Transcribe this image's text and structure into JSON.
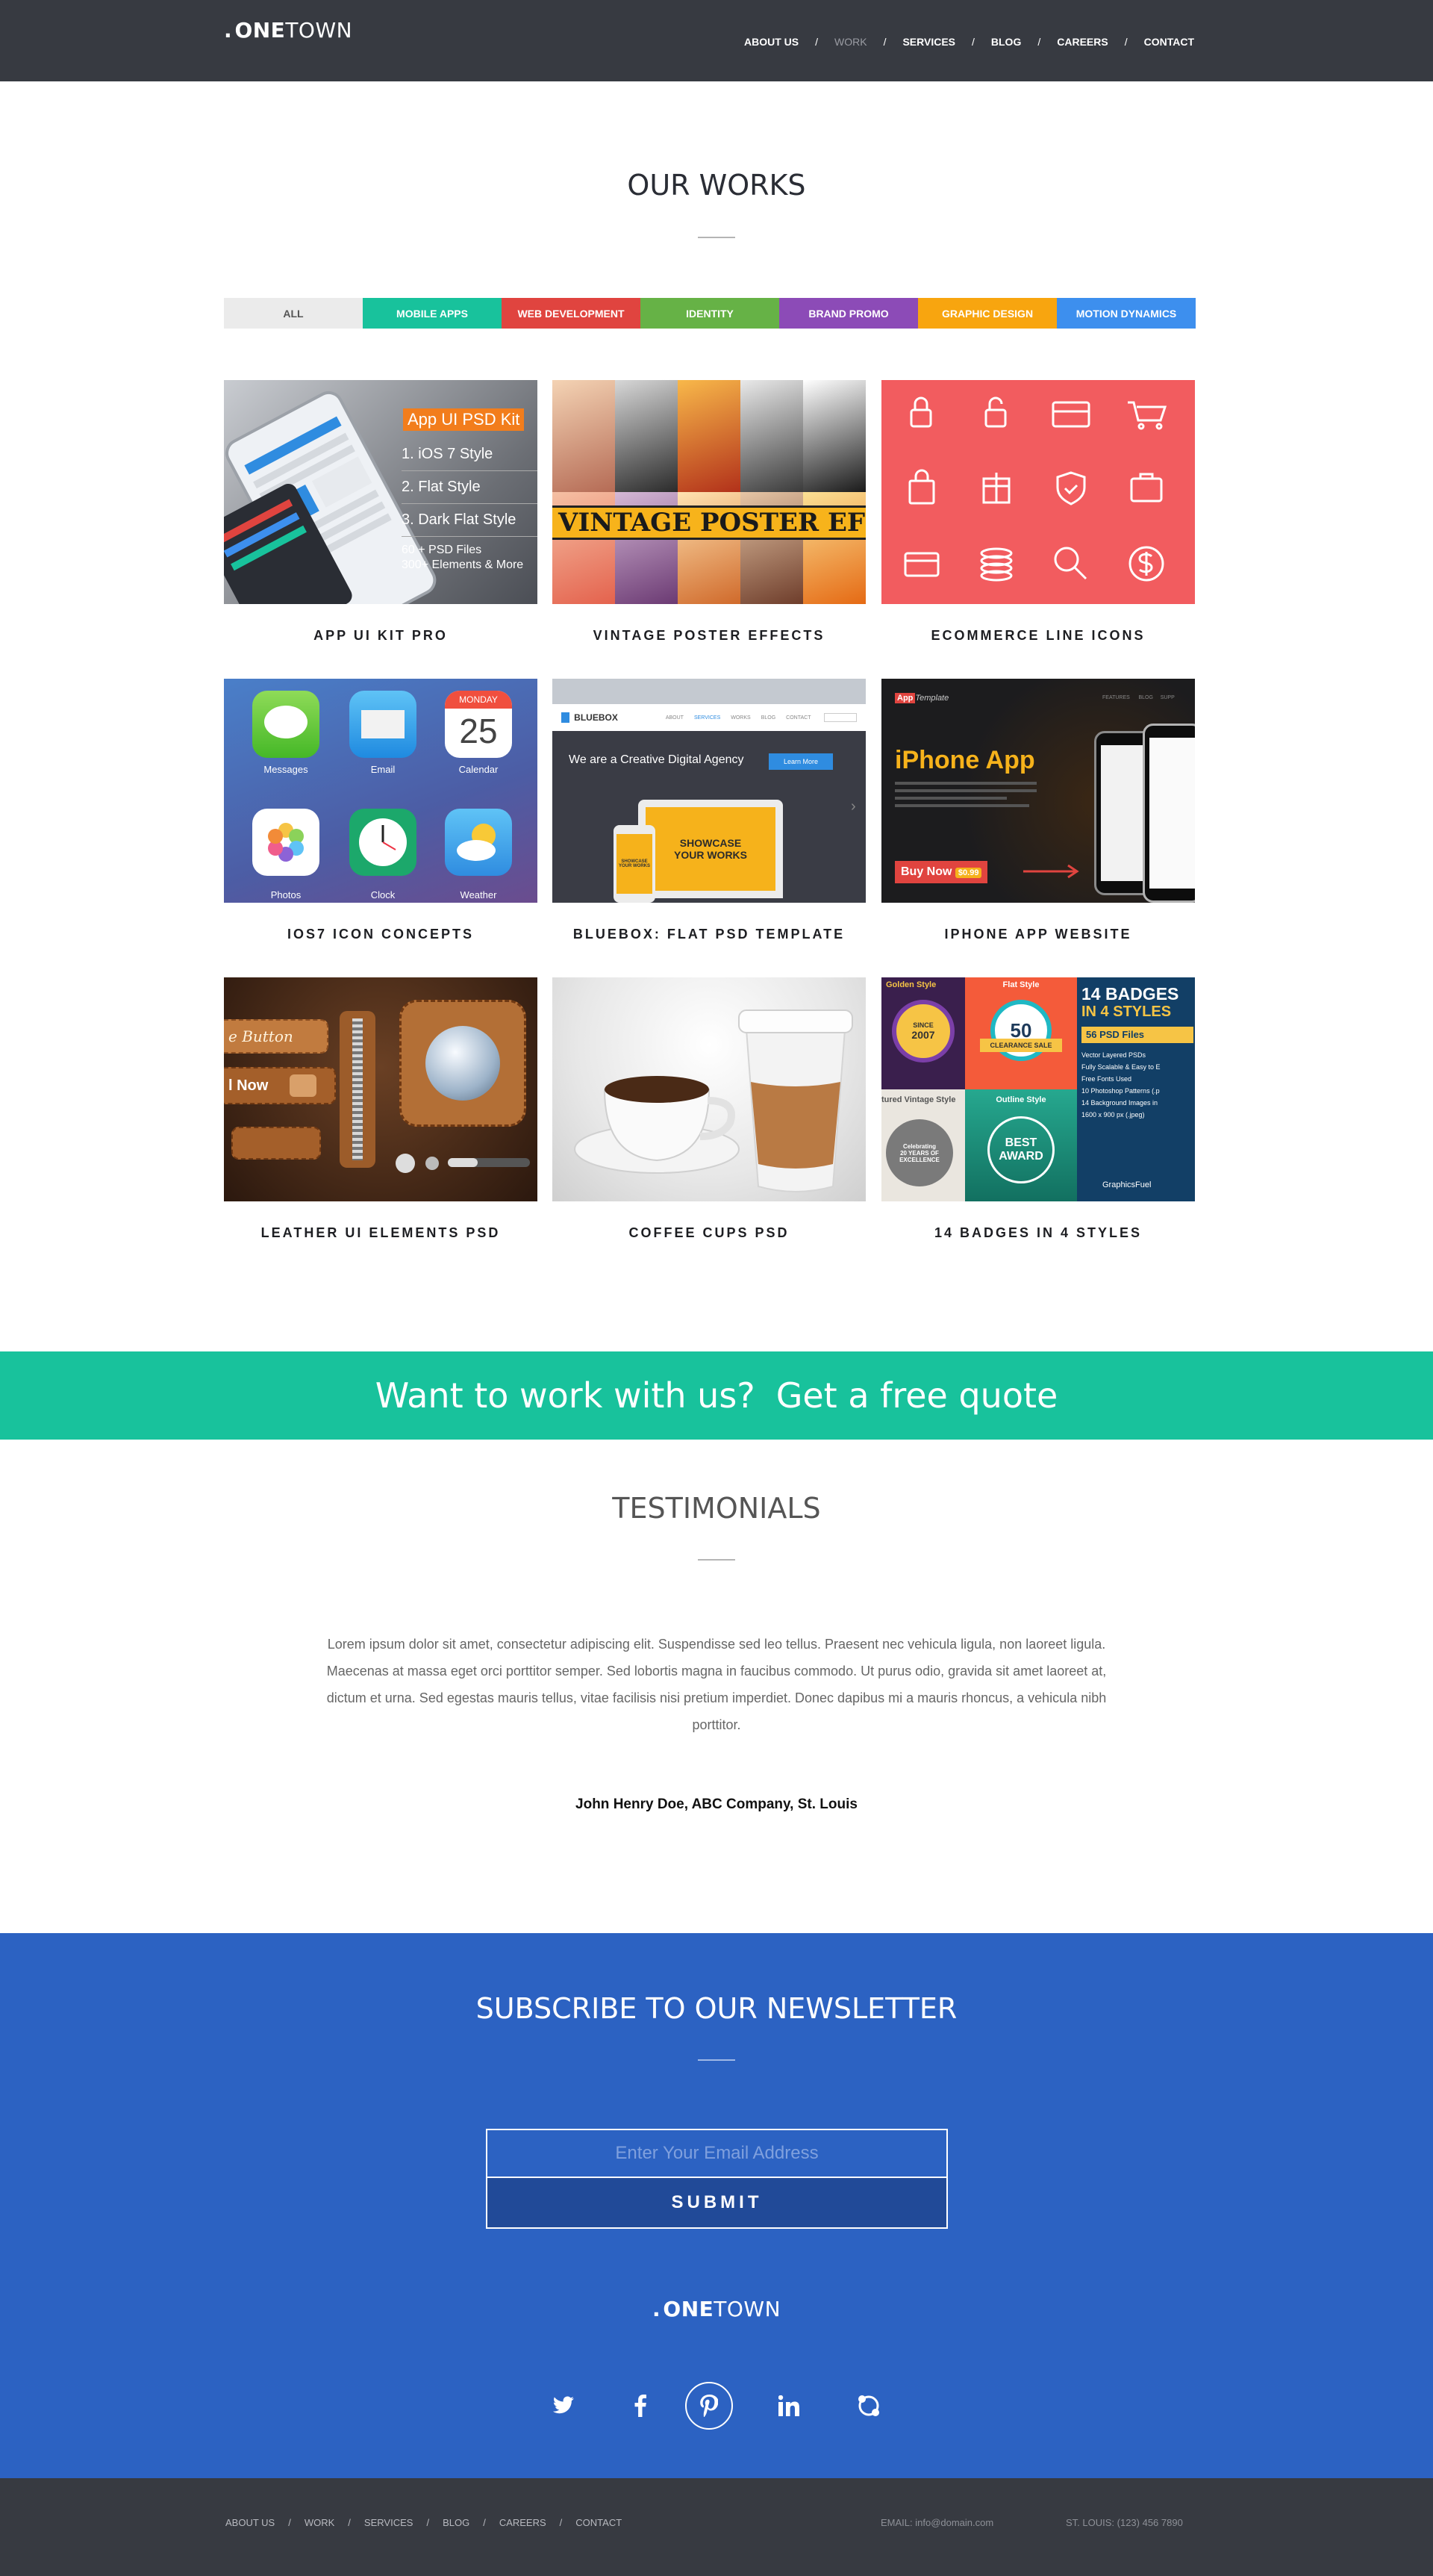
{
  "header": {
    "logo_dot": ".",
    "logo_bold": "ONE",
    "logo_light": "TOWN",
    "nav": [
      "ABOUT US",
      "WORK",
      "SERVICES",
      "BLOG",
      "CAREERS",
      "CONTACT"
    ],
    "active": "WORK",
    "sep": "/"
  },
  "works": {
    "title": "OUR WORKS",
    "filters": [
      {
        "label": "ALL",
        "color": "#ebebeb"
      },
      {
        "label": "MOBILE APPS",
        "color": "#18c29c"
      },
      {
        "label": "WEB DEVELOPMENT",
        "color": "#e0443f"
      },
      {
        "label": "IDENTITY",
        "color": "#66b246"
      },
      {
        "label": "BRAND PROMO",
        "color": "#8c4bb7"
      },
      {
        "label": "GRAPHIC DESIGN",
        "color": "#f8a50f"
      },
      {
        "label": "MOTION DYNAMICS",
        "color": "#3d8fee"
      }
    ],
    "items": [
      "APP UI KIT PRO",
      "VINTAGE POSTER EFFECTS",
      "ECOMMERCE LINE ICONS",
      "IOS7 ICON CONCEPTS",
      "BLUEBOX: FLAT PSD TEMPLATE",
      "IPHONE APP WEBSITE",
      "LEATHER UI ELEMENTS PSD",
      "COFFEE CUPS PSD",
      "14 BADGES IN 4 STYLES"
    ]
  },
  "thumbs": {
    "appkit": {
      "banner": "App UI PSD Kit",
      "list": [
        "1.  iOS 7 Style",
        "2.  Flat Style",
        "3.  Dark Flat Style"
      ],
      "foot1": "60 + PSD Files",
      "foot2": "300+ Elements & More"
    },
    "vintage": {
      "banner": "VINTAGE POSTER EFF"
    },
    "ios7": {
      "labels": [
        "Messages",
        "Email",
        "Calendar",
        "Photos",
        "Clock",
        "Weather"
      ],
      "cal_day": "MONDAY",
      "cal_num": "25"
    },
    "bluebox": {
      "brand": "BLUEBOX",
      "nav": [
        "ABOUT",
        "SERVICES",
        "WORKS",
        "BLOG",
        "CONTACT"
      ],
      "headline": "We are a Creative Digital Agency",
      "btn": "Learn More",
      "screen1": "SHOWCASE",
      "screen2": "YOUR WORKS",
      "small1": "SHOWCASE",
      "small2": "YOUR WORKS"
    },
    "iphone": {
      "badge": "App",
      "brand": "Template",
      "nav": [
        "FEATURES",
        "BLOG",
        "SUPP"
      ],
      "headline": "iPhone App",
      "buy": "Buy Now",
      "price": "$0.99"
    },
    "leather": {
      "btn1": "e Button",
      "btn2": "l Now"
    },
    "badges": {
      "golden": "Golden Style",
      "flat": "Flat Style",
      "title1": "14 BADGES",
      "title2": "IN 4 STYLES",
      "psd": "56 PSD Files",
      "vintage": "tured Vintage Style",
      "outline": "Outline Style",
      "best1": "BEST",
      "best2": "AWARD",
      "since": "SINCE",
      "year": "2007",
      "pct": "50",
      "sale": "CLEARANCE SALE",
      "anniv": "20 YEARS OF",
      "excel": "EXCELLENCE",
      "celeb": "Celebrating",
      "feat": [
        "Vector Layered PSDs",
        "Fully Scalable & Easy to E",
        "Free Fonts Used",
        "10 Photoshop Patterns (.p",
        "14 Background Images in",
        "1600 x 900 px (.jpeg)"
      ],
      "gf": "GraphicsFuel"
    }
  },
  "cta": {
    "part1": "Want to work with us?",
    "part2": "Get a free quote"
  },
  "testimonials": {
    "title": "TESTIMONIALS",
    "quote": "Lorem ipsum dolor sit amet, consectetur adipiscing elit. Suspendisse sed leo tellus. Praesent nec vehicula ligula, non laoreet ligula. Maecenas at massa eget orci porttitor semper. Sed lobortis magna in faucibus commodo. Ut purus odio, gravida sit amet laoreet at, dictum et urna. Sed egestas mauris tellus, vitae facilisis nisi pretium imperdiet. Donec dapibus mi a mauris rhoncus, a vehicula nibh porttitor.",
    "author": "John Henry Doe, ABC Company, St. Louis"
  },
  "newsletter": {
    "title": "SUBSCRIBE TO OUR NEWSLETTER",
    "placeholder": "Enter Your Email Address",
    "submit": "SUBMIT"
  },
  "social": [
    "twitter-icon",
    "facebook-icon",
    "pinterest-icon",
    "linkedin-icon",
    "skype-icon"
  ],
  "footer": {
    "nav": [
      "ABOUT US",
      "WORK",
      "SERVICES",
      "BLOG",
      "CAREERS",
      "CONTACT"
    ],
    "email": "EMAIL: info@domain.com",
    "phone": "ST. LOUIS:  (123)  456  7890"
  }
}
